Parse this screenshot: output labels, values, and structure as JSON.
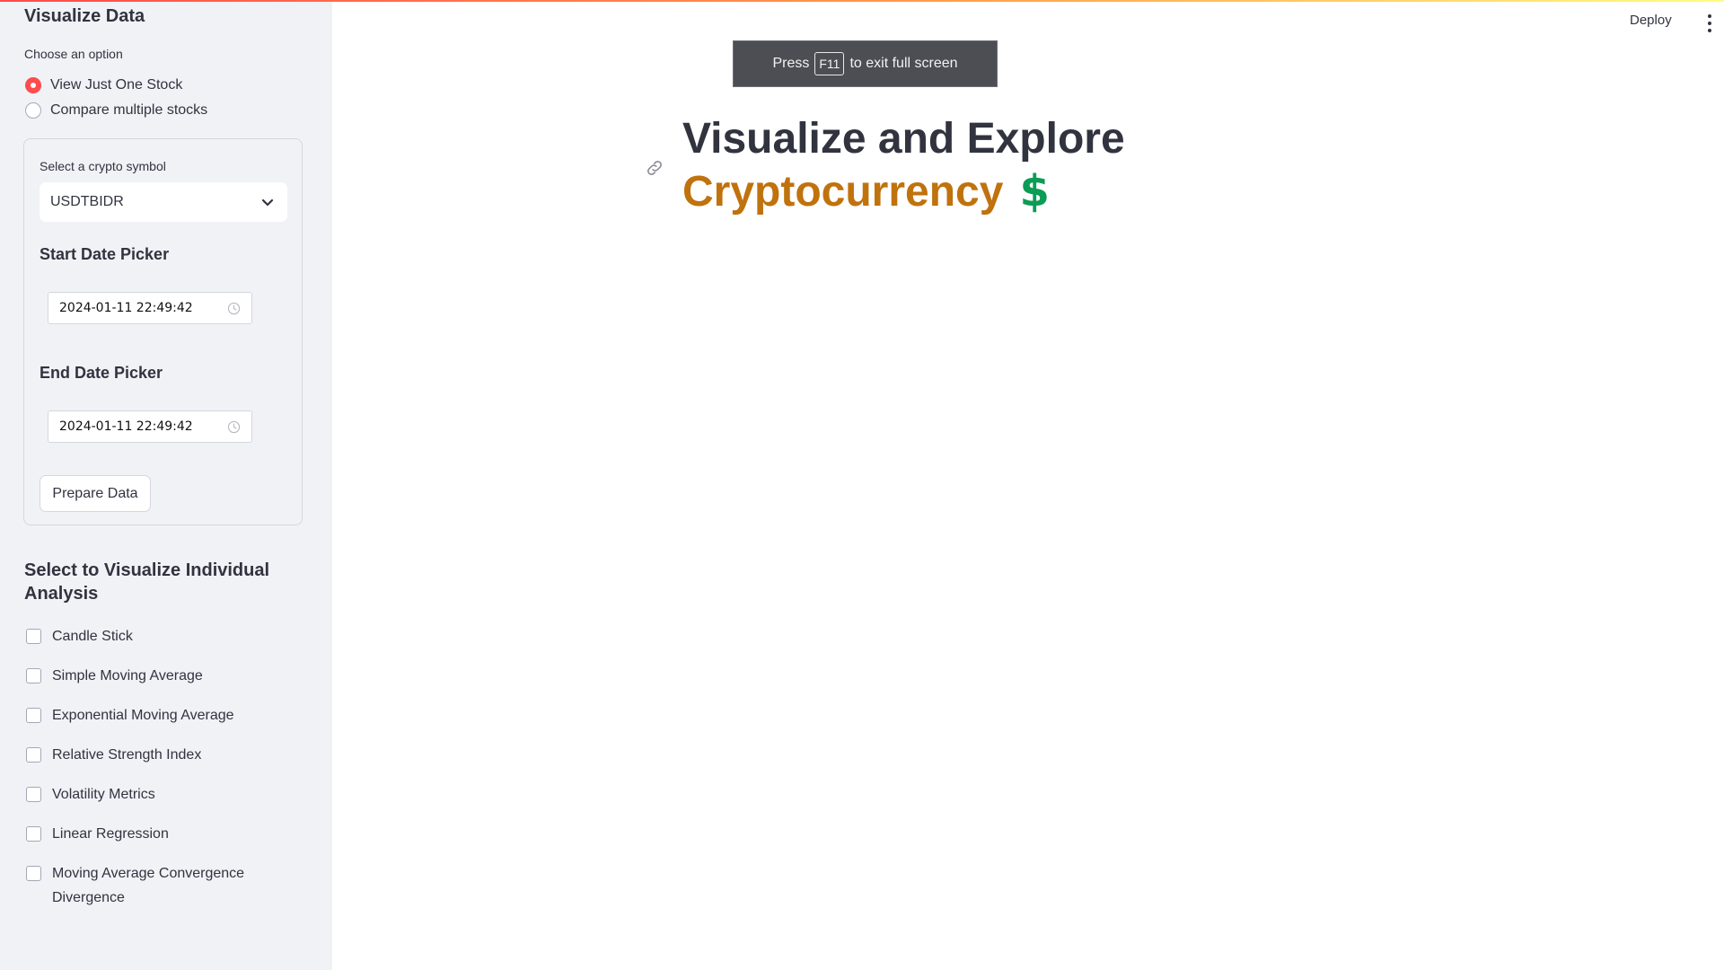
{
  "sidebar": {
    "title": "Visualize Data",
    "choose_label": "Choose an option",
    "radios": [
      {
        "label": "View Just One Stock",
        "selected": true
      },
      {
        "label": "Compare multiple stocks",
        "selected": false
      }
    ],
    "form": {
      "symbol_label": "Select a crypto symbol",
      "symbol_value": "USDTBIDR",
      "start_label": "Start Date Picker",
      "start_value": "2024-01-11 22:49:42",
      "end_label": "End Date Picker",
      "end_value": "2024-01-11 22:49:42",
      "prepare_button": "Prepare Data"
    },
    "analysis_title": "Select to Visualize Individual Analysis",
    "analysis_options": [
      "Candle Stick",
      "Simple Moving Average",
      "Exponential Moving Average",
      "Relative Strength Index",
      "Volatility Metrics",
      "Linear Regression",
      "Moving Average Convergence Divergence"
    ]
  },
  "header": {
    "deploy_label": "Deploy",
    "menu_icon": "kebab-menu-icon"
  },
  "fullscreen_notice": {
    "press": "Press",
    "key": "F11",
    "suffix": "to exit full screen"
  },
  "main": {
    "title_line1": "Visualize and Explore",
    "title_line2": "Cryptocurrency",
    "title_emoji": "$",
    "link_icon": "link-icon"
  },
  "colors": {
    "accent_red": "#ff4b4b",
    "title_orange": "#c0720d",
    "dollar_green": "#0b9c55",
    "sidebar_bg": "#f0f2f6"
  }
}
